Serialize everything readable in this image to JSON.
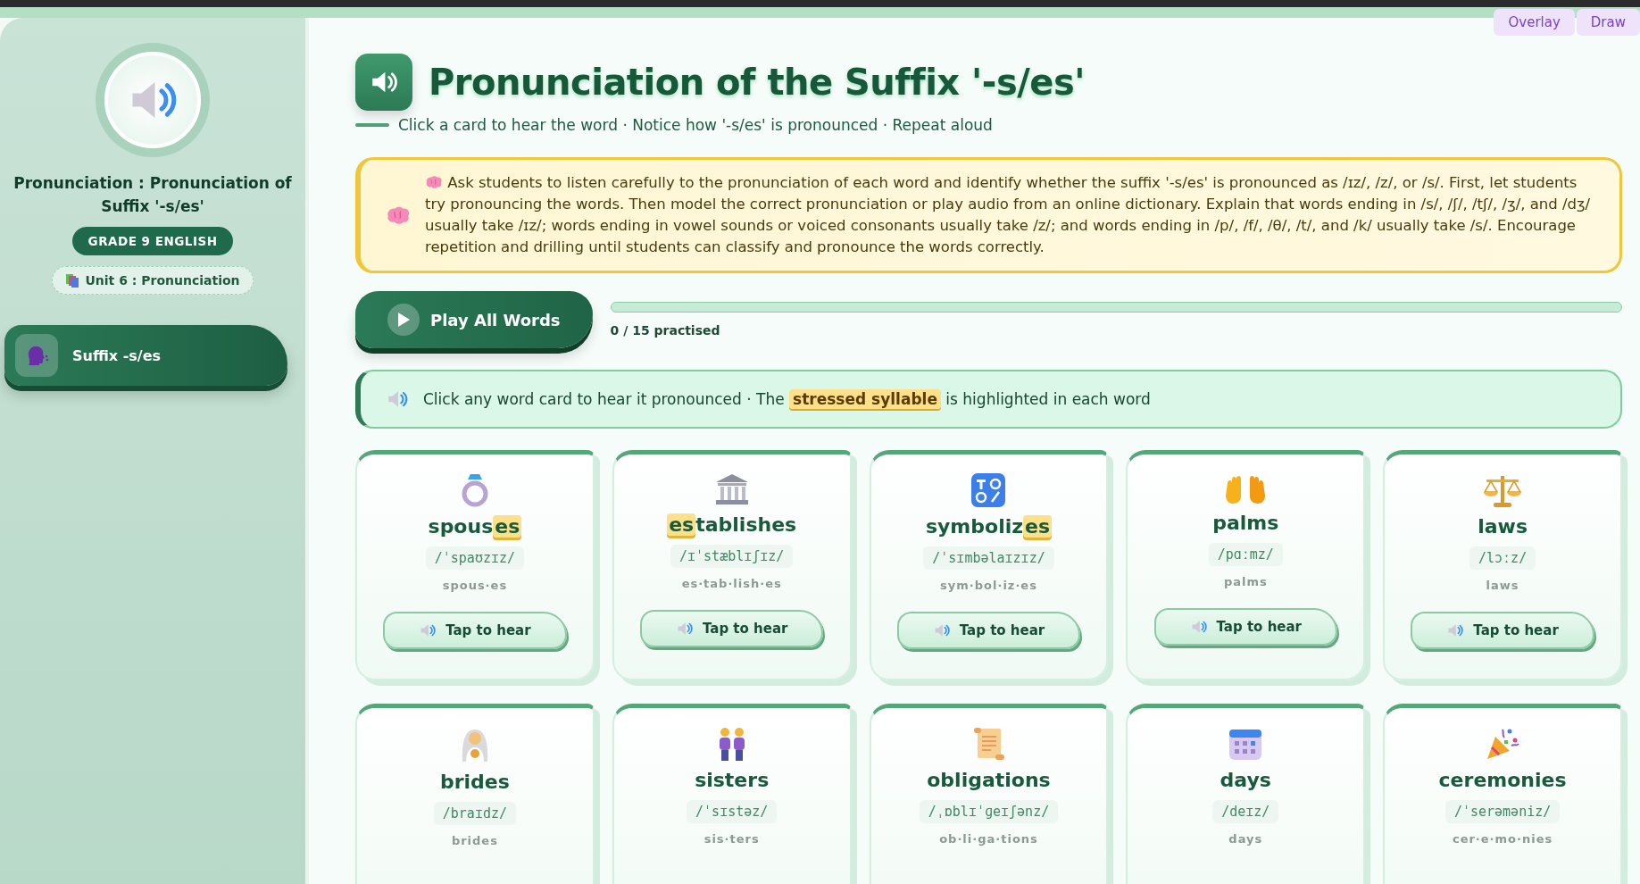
{
  "top_buttons": [
    {
      "label": "Overlay"
    },
    {
      "label": "Draw"
    }
  ],
  "sidebar": {
    "title": "Pronunciation : Pronunciation of Suffix '-s/es'",
    "grade": "GRADE 9 ENGLISH",
    "unit": "Unit 6 : Pronunciation",
    "nav_items": [
      {
        "label": "Suffix -s/es",
        "selected": true
      }
    ]
  },
  "header": {
    "title": "Pronunciation of the Suffix '-s/es'",
    "subtitle": "Click a card to hear the word · Notice how '-s/es' is pronounced · Repeat aloud"
  },
  "teacher_note": "Ask students to listen carefully to the pronunciation of each word and identify whether the suffix '-s/es' is pronounced as /ɪz/, /z/, or /s/. First, let students try pronouncing the words. Then model the correct pronunciation or play audio from an online dictionary. Explain that words ending in /s/, /ʃ/, /tʃ/, /ʒ/, and /dʒ/ usually take /ɪz/; words ending in vowel sounds or voiced consonants usually take /z/; and words ending in /p/, /f/, /θ/, /t/, and /k/ usually take /s/. Encourage repetition and drilling until students can classify and pronounce the words correctly.",
  "play_all": {
    "label": "Play All Words",
    "progress": "0 / 15 practised",
    "level": 0
  },
  "info": {
    "before": "Click any word card to hear it pronounced · The",
    "highlight": "stressed syllable",
    "after": "is highlighted in each word"
  },
  "cards": [
    {
      "parts": [
        {
          "text": "spous",
          "stressed": false
        },
        {
          "text": "es",
          "stressed": true
        }
      ],
      "ipa": "/ˈspaʊzɪz/",
      "syllables": "spous·es",
      "button": "Tap to hear"
    },
    {
      "parts": [
        {
          "text": "es",
          "stressed": true
        },
        {
          "text": "tablishes",
          "stressed": false
        }
      ],
      "ipa": "/ɪˈstæblɪʃɪz/",
      "syllables": "es·tab·lish·es",
      "button": "Tap to hear"
    },
    {
      "parts": [
        {
          "text": "symboliz",
          "stressed": false
        },
        {
          "text": "es",
          "stressed": true
        }
      ],
      "ipa": "/ˈsɪmbəlaɪzɪz/",
      "syllables": "sym·bol·iz·es",
      "button": "Tap to hear"
    },
    {
      "parts": [
        {
          "text": "palms",
          "stressed": false
        }
      ],
      "ipa": "/pɑːmz/",
      "syllables": "palms",
      "button": "Tap to hear"
    },
    {
      "parts": [
        {
          "text": "laws",
          "stressed": false
        }
      ],
      "ipa": "/lɔːz/",
      "syllables": "laws",
      "button": "Tap to hear"
    },
    {
      "parts": [
        {
          "text": "brides",
          "stressed": false
        }
      ],
      "ipa": "/braɪdz/",
      "syllables": "brides"
    },
    {
      "parts": [
        {
          "text": "sisters",
          "stressed": false
        }
      ],
      "ipa": "/ˈsɪstəz/",
      "syllables": "sis·ters"
    },
    {
      "parts": [
        {
          "text": "obligations",
          "stressed": false
        }
      ],
      "ipa": "/ˌɒblɪˈɡeɪʃənz/",
      "syllables": "ob·li·ga·tions"
    },
    {
      "parts": [
        {
          "text": "days",
          "stressed": false
        }
      ],
      "ipa": "/deɪz/",
      "syllables": "days"
    },
    {
      "parts": [
        {
          "text": "ceremonies",
          "stressed": false
        }
      ],
      "ipa": "/ˈserəməniz/",
      "syllables": "cer·e·mo·nies"
    }
  ]
}
